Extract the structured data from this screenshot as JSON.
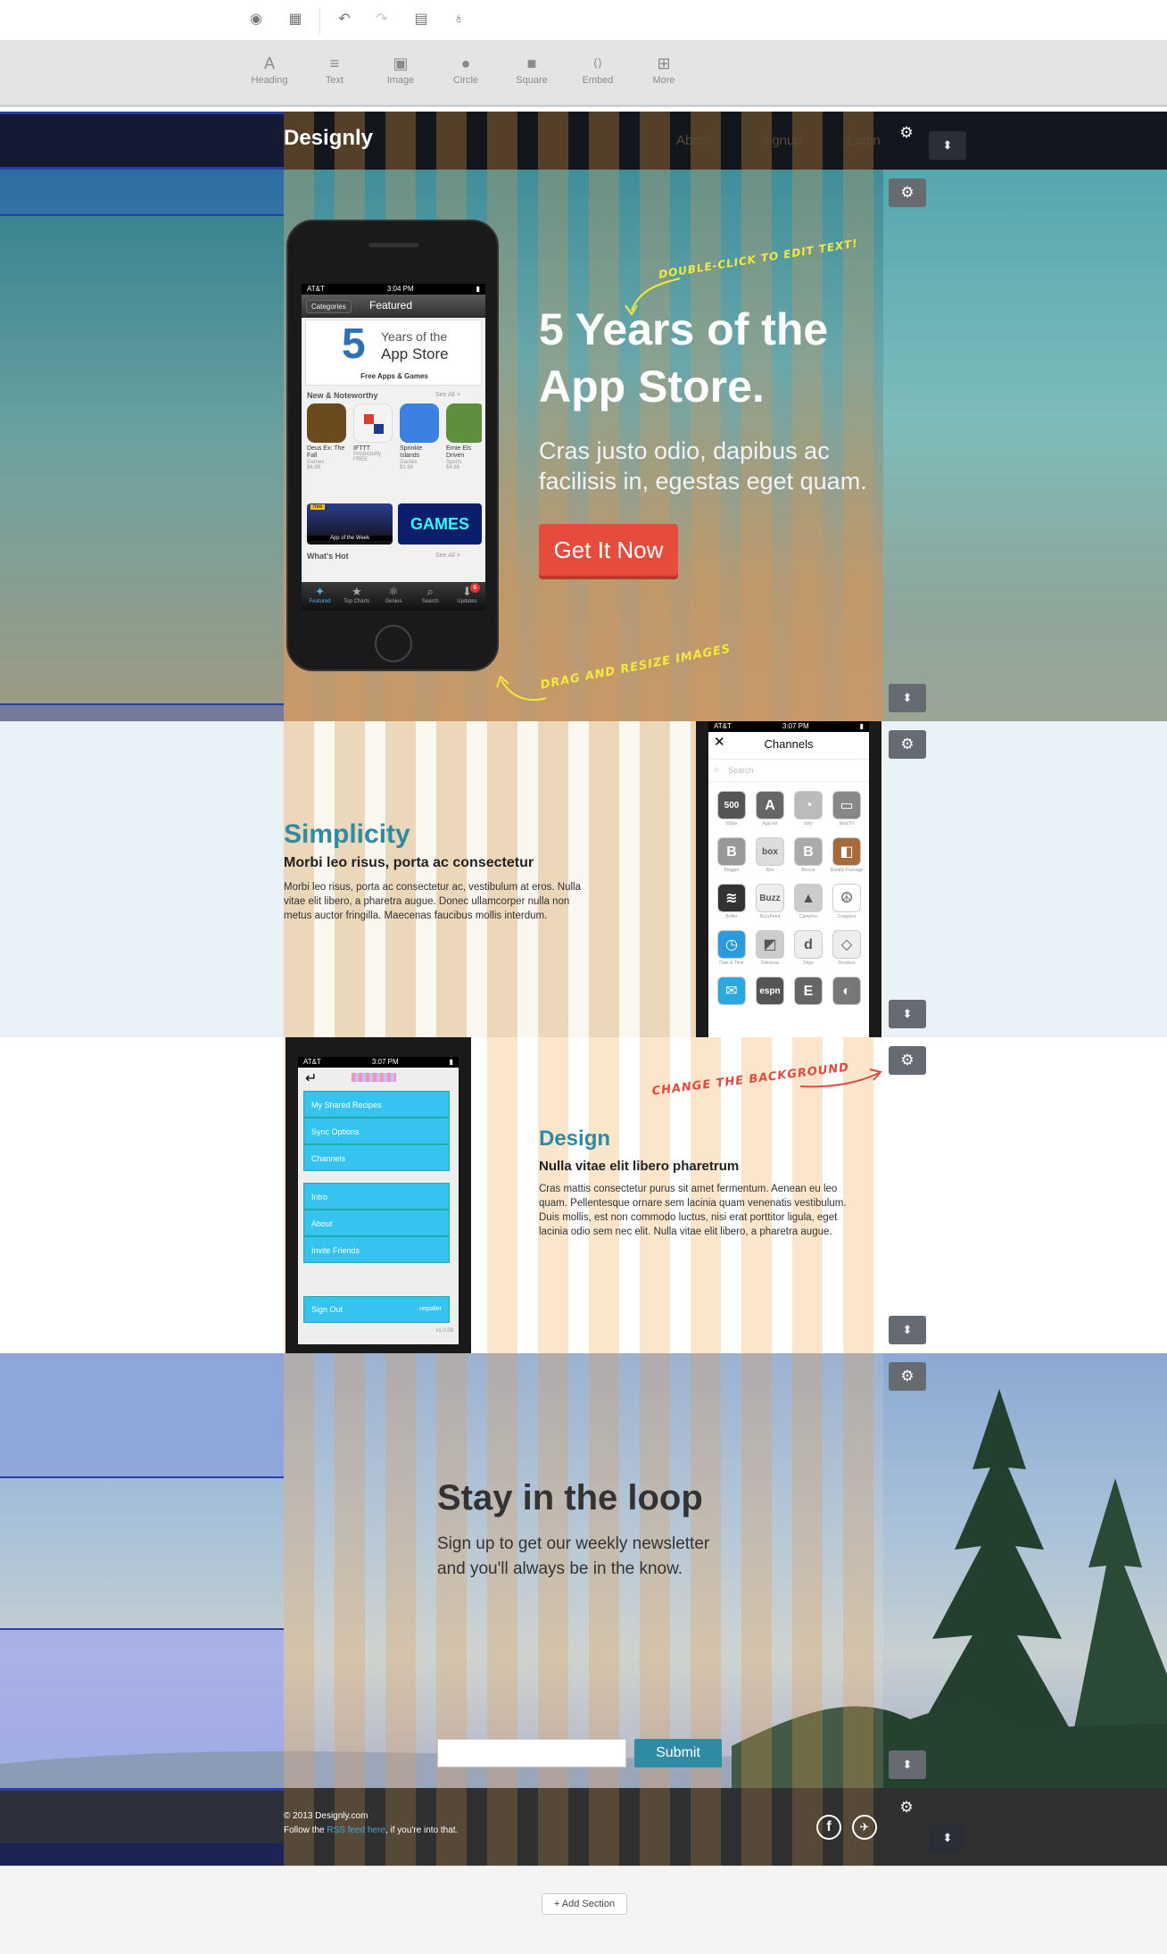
{
  "topbar": {
    "icons": [
      "preview-icon",
      "layout-icon",
      "undo-icon",
      "redo-icon",
      "clipboard-icon",
      "lightbulb-icon"
    ]
  },
  "toolbar": {
    "tools": [
      {
        "label": "Heading",
        "icon": "A"
      },
      {
        "label": "Text",
        "icon": "≡"
      },
      {
        "label": "Image",
        "icon": "▣"
      },
      {
        "label": "Circle",
        "icon": "●"
      },
      {
        "label": "Square",
        "icon": "■"
      },
      {
        "label": "Embed",
        "icon": "⟨⟩"
      },
      {
        "label": "More",
        "icon": "⊞"
      }
    ]
  },
  "nav": {
    "brand": "Designly",
    "links": [
      "About",
      "Signup",
      "Login"
    ]
  },
  "hero": {
    "title_line1": "5 Years of the",
    "title_line2": "App Store.",
    "subtitle_line1": "Cras justo odio, dapibus ac",
    "subtitle_line2": "facilisis in, egestas eget quam.",
    "cta": "Get It Now",
    "hint_top": "DOUBLE-CLICK TO EDIT TEXT!",
    "hint_bottom": "DRAG AND RESIZE IMAGES",
    "phone": {
      "carrier": "AT&T",
      "time": "3:04 PM",
      "tab_categories": "Categories",
      "header": "Featured",
      "banner_num": "5",
      "banner_line1": "Years of the",
      "banner_line2": "App Store",
      "banner_sub": "Free Apps & Games",
      "section1": "New & Noteworthy",
      "see_all": "See All >",
      "apps": [
        {
          "name": "Deus Ex: The Fall",
          "cat": "Games",
          "price": "$6.99",
          "color": "#6b4a1d"
        },
        {
          "name": "IFTTT",
          "cat": "Productivity",
          "price": "FREE",
          "color": "#f4f4f4"
        },
        {
          "name": "Sprinkle Islands",
          "cat": "Games",
          "price": "$1.99",
          "color": "#3b82e0"
        },
        {
          "name": "Ernie Els Driven",
          "cat": "Sports",
          "price": "$4.99",
          "color": "#5e8f3e"
        }
      ],
      "promo1": "App of the Week",
      "promo1_badge": "free",
      "promo2": "GAMES",
      "section2": "What's Hot",
      "see_all2": "See All >",
      "tabs": [
        "Featured",
        "Top Charts",
        "Genius",
        "Search",
        "Updates"
      ],
      "update_badge": "6"
    }
  },
  "simplicity": {
    "title": "Simplicity",
    "subtitle": "Morbi leo risus, porta ac consectetur",
    "body": "Morbi leo risus, porta ac consectetur ac, vestibulum at eros. Nulla vitae elit libero, a pharetra augue. Donec ullamcorper nulla non metus auctor fringilla. Maecenas faucibus mollis interdum.",
    "phone": {
      "carrier": "AT&T",
      "time": "3:07 PM",
      "header": "Channels",
      "search": "Search",
      "channels": [
        {
          "label": "500px",
          "glyph": "500",
          "color": "#555"
        },
        {
          "label": "App.net",
          "glyph": "A",
          "color": "#666"
        },
        {
          "label": "bitly",
          "glyph": "◔",
          "color": "#bbb"
        },
        {
          "label": "blinkTV",
          "glyph": "▭",
          "color": "#888"
        },
        {
          "label": "Blogger",
          "glyph": "B",
          "color": "#999"
        },
        {
          "label": "Box",
          "glyph": "box",
          "color": "#ddd"
        },
        {
          "label": "Boxcar",
          "glyph": "B",
          "color": "#aaa"
        },
        {
          "label": "Bundle Package",
          "glyph": "◧",
          "color": "#a56b3a"
        },
        {
          "label": "Buffer",
          "glyph": "≋",
          "color": "#333"
        },
        {
          "label": "BuzzFeed",
          "glyph": "Buzz",
          "color": "#eee"
        },
        {
          "label": "Campfire",
          "glyph": "▲",
          "color": "#ccc"
        },
        {
          "label": "Craigslist",
          "glyph": "☮",
          "color": "#fff"
        },
        {
          "label": "Date & Time",
          "glyph": "◷",
          "color": "#2a9be0"
        },
        {
          "label": "Delicious",
          "glyph": "◩",
          "color": "#ccc"
        },
        {
          "label": "Diigo",
          "glyph": "d",
          "color": "#eee"
        },
        {
          "label": "Dropbox",
          "glyph": "◇",
          "color": "#eee"
        },
        {
          "label": "",
          "glyph": "✉",
          "color": "#2aa8e0"
        },
        {
          "label": "",
          "glyph": "espn",
          "color": "#555"
        },
        {
          "label": "",
          "glyph": "E",
          "color": "#666"
        },
        {
          "label": "",
          "glyph": "◐",
          "color": "#777"
        }
      ]
    }
  },
  "design": {
    "title": "Design",
    "subtitle": "Nulla vitae elit libero pharetrum",
    "body": "Cras mattis consectetur purus sit amet fermentum. Aenean eu leo quam. Pellentesque ornare sem lacinia quam venenatis vestibulum. Duis mollis, est non commodo luctus, nisi erat porttitor ligula, eget lacinia odio sem nec elit. Nulla vitae elit libero, a pharetra augue.",
    "hint": "CHANGE THE BACKGROUND",
    "phone": {
      "carrier": "AT&T",
      "time": "3:07 PM",
      "menu1": [
        "My Shared Recipes",
        "Sync Options",
        "Channels"
      ],
      "menu2": [
        "Intro",
        "About",
        "Invite Friends"
      ],
      "signout": "Sign Out",
      "user": "nepaller",
      "version": "v1.0.09"
    }
  },
  "newsletter": {
    "title": "Stay in the loop",
    "text": "Sign up to get our weekly newsletter and you'll always be in the know.",
    "placeholder": "",
    "submit": "Submit"
  },
  "footer": {
    "copyright": "© 2013 Designly.com",
    "follow_pre": "Follow the ",
    "rss": "RSS feed here",
    "follow_post": ", if you're into that.",
    "social": [
      "facebook-icon",
      "twitter-icon"
    ]
  },
  "add_section": "+ Add Section",
  "colors": {
    "accent": "#2f8ba3",
    "cta": "#e64b3c",
    "hint_yellow": "#f3ea3c",
    "hint_red": "#e0493e"
  }
}
